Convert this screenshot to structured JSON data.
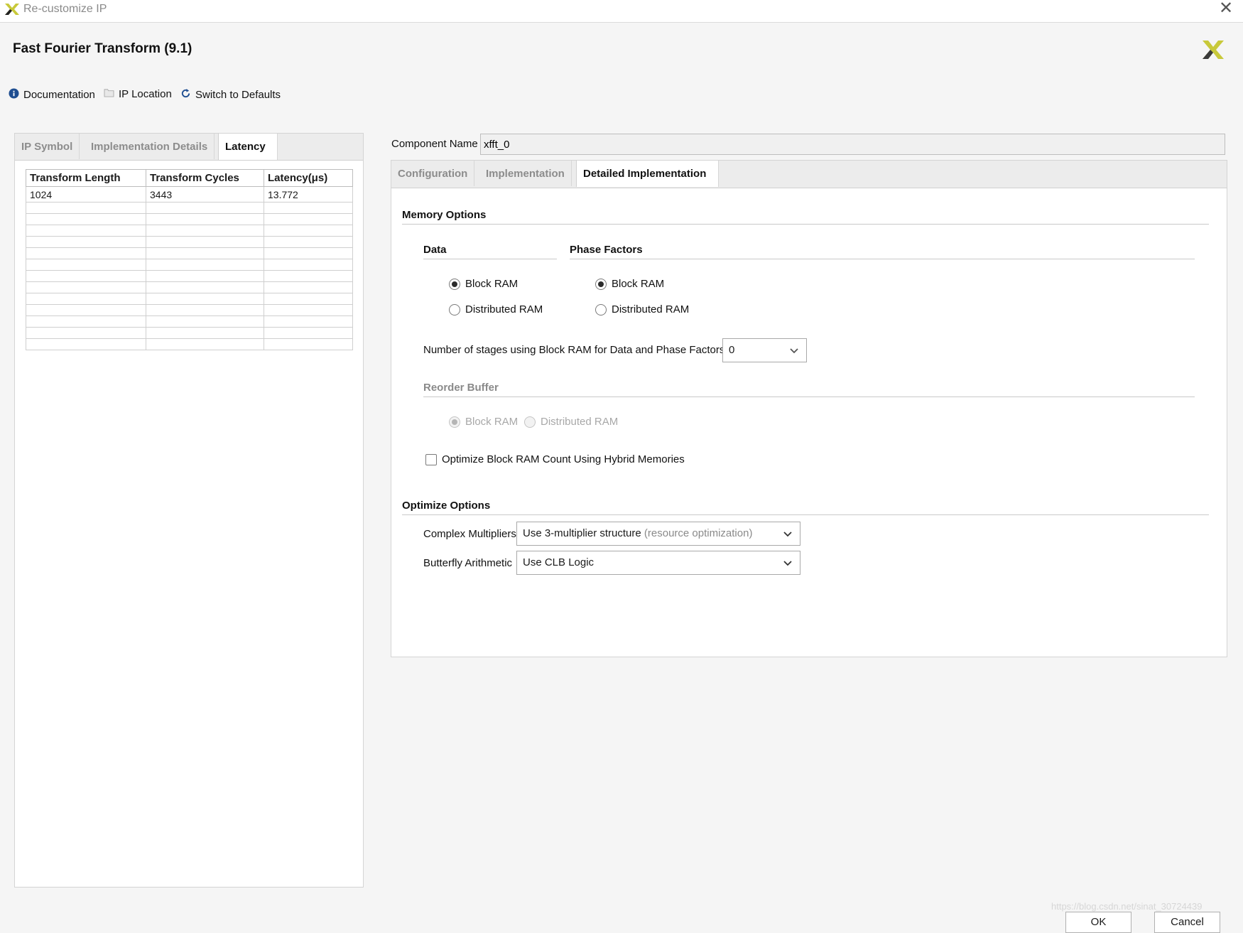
{
  "window": {
    "title": "Re-customize IP",
    "close_glyph": "✕"
  },
  "header": {
    "title": "Fast Fourier Transform (9.1)"
  },
  "toolbar": {
    "documentation": "Documentation",
    "ip_location": "IP Location",
    "switch_defaults": "Switch to Defaults"
  },
  "left_tabs": [
    "IP Symbol",
    "Implementation Details",
    "Latency"
  ],
  "latency_table": {
    "headers": [
      "Transform Length",
      "Transform Cycles",
      "Latency(μs)"
    ],
    "rows": [
      [
        "1024",
        "3443",
        "13.772"
      ]
    ]
  },
  "component": {
    "label": "Component Name",
    "value": "xfft_0"
  },
  "right_tabs": [
    "Configuration",
    "Implementation",
    "Detailed Implementation"
  ],
  "memory_options": {
    "title": "Memory Options",
    "data": {
      "title": "Data",
      "block_ram": "Block RAM",
      "distributed_ram": "Distributed RAM",
      "selected": "Block RAM"
    },
    "phase": {
      "title": "Phase Factors",
      "block_ram": "Block RAM",
      "distributed_ram": "Distributed RAM",
      "selected": "Block RAM"
    },
    "stages_label": "Number of stages using Block RAM for Data and Phase Factors",
    "stages_value": "0",
    "reorder": {
      "title": "Reorder Buffer",
      "block_ram": "Block RAM",
      "distributed_ram": "Distributed RAM",
      "selected": "Block RAM",
      "disabled": true
    },
    "hybrid_label": "Optimize Block RAM Count Using Hybrid Memories",
    "hybrid_checked": false
  },
  "optimize_options": {
    "title": "Optimize Options",
    "complex_label": "Complex Multipliers",
    "complex_value": "Use 3-multiplier structure",
    "complex_hint": "(resource optimization)",
    "butterfly_label": "Butterfly Arithmetic",
    "butterfly_value": "Use CLB Logic"
  },
  "footer": {
    "ok": "OK",
    "cancel": "Cancel",
    "watermark": "https://blog.csdn.net/sinat_30724439"
  },
  "colors": {
    "xilinx_logo": "#c8c93a",
    "info_icon": "#1f4e91"
  }
}
